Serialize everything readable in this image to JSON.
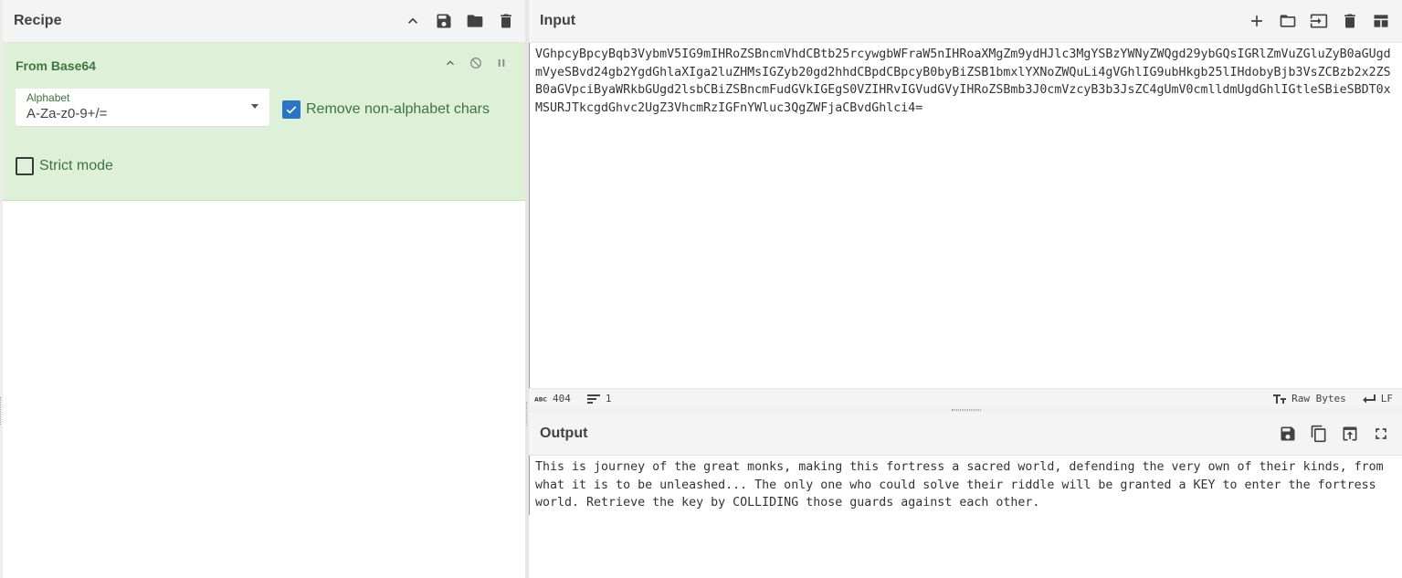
{
  "recipe": {
    "title": "Recipe",
    "icons": [
      "chevron-up-icon",
      "save-icon",
      "folder-icon",
      "trash-icon"
    ]
  },
  "operation": {
    "name": "From Base64",
    "alphabet_label": "Alphabet",
    "alphabet_value": "A-Za-z0-9+/=",
    "remove_nonalphabet_label": "Remove non-alphabet chars",
    "remove_nonalphabet_checked": true,
    "strict_mode_label": "Strict mode",
    "strict_mode_checked": false
  },
  "input": {
    "title": "Input",
    "text": "VGhpcyBpcyBqb3VybmV5IG9mIHRoZSBncmVhdCBtb25rcywgbWFraW5nIHRoaXMgZm9ydHJlc3MgYSBzYWNyZWQgd29ybGQsIGRlZmVuZGluZyB0aGUgdmVyeSBvd24gb2YgdGhlaXIga2luZHMsIGZyb20gd2hhdCBpdCBpcyB0byBiZSB1bmxlYXNoZWQuLi4gVGhlIG9ubHkgb25lIHdobyBjb3VsZCBzb2x2ZSB0aGVpciByaWRkbGUgd2lsbCBiZSBncmFudGVkIGEgS0VZIHRvIGVudGVyIHRoZSBmb3J0cmVzcyB3b3JsZC4gUmV0cmlldmUgdGhlIGtleSBieSBDT0xMSURJTkcgdGhvc2UgZ3VhcmRzIGFnYWluc3QgZWFjaCBvdGhlci4=",
    "char_count": "404",
    "line_count": "1",
    "encoding": "Raw Bytes",
    "eol": "LF"
  },
  "output": {
    "title": "Output",
    "text": "This is journey of the great monks, making this fortress a sacred world, defending the very own of their kinds, from what it is to be unleashed... The only one who could solve their riddle will be granted a KEY to enter the fortress world. Retrieve the key by COLLIDING those guards against each other."
  }
}
